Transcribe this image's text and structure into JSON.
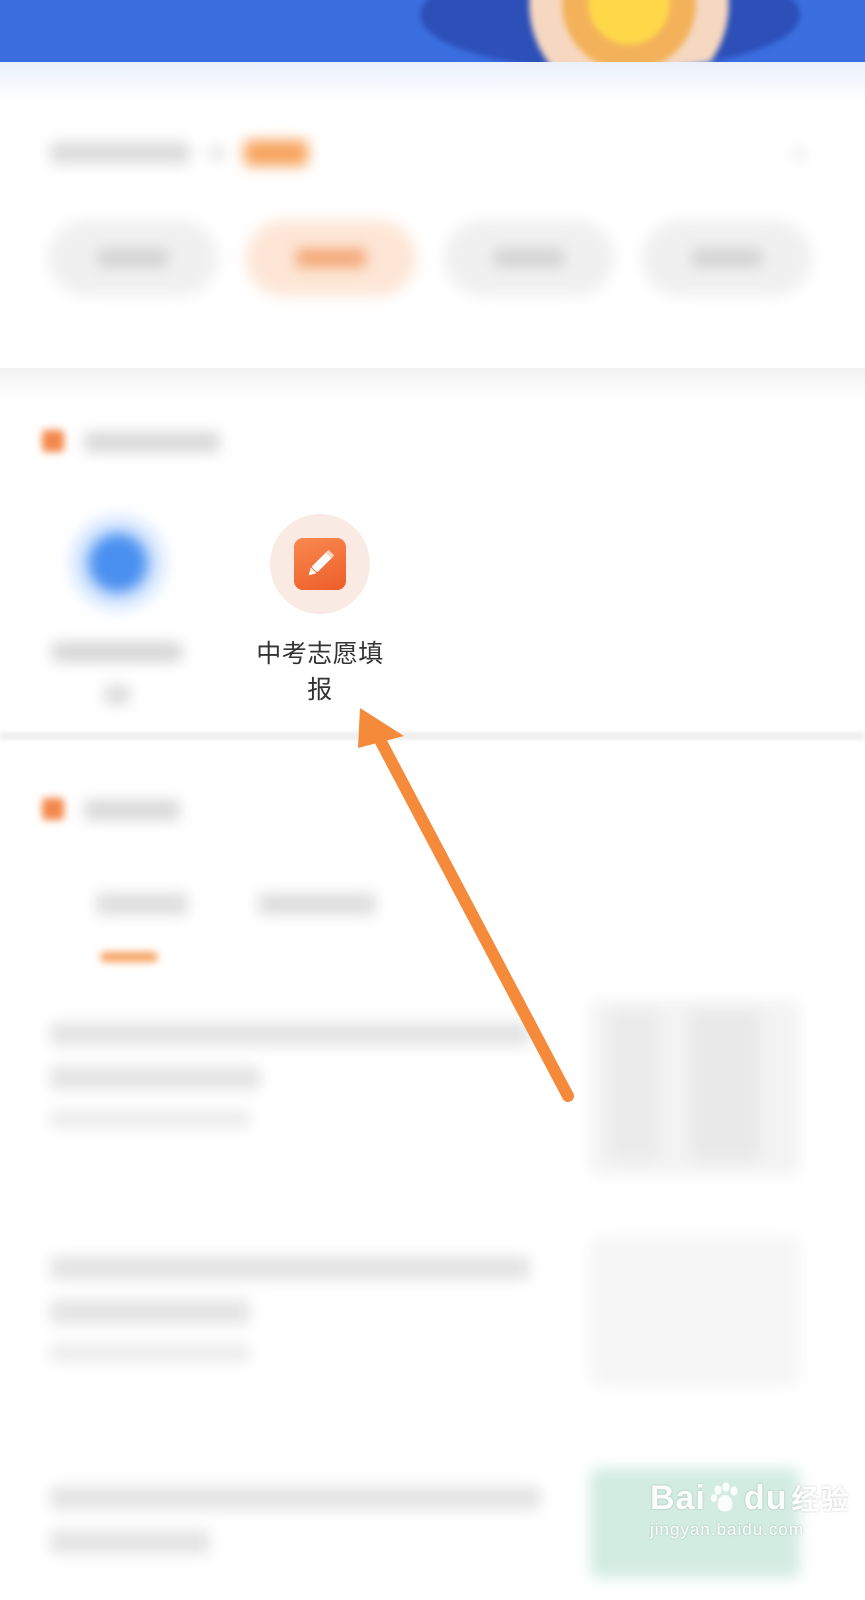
{
  "colors": {
    "brand_blue": "#3b6fe0",
    "accent_orange": "#f4874b",
    "arrow_orange": "#f48a3a",
    "tool_icon_bg": "#f9ebe4"
  },
  "tools": {
    "featured": {
      "label": "中考志愿填报",
      "icon": "pencil-edit-icon"
    }
  },
  "annotation": {
    "type": "arrow",
    "points_to": "tool-item-zhongkao-zhiyuan"
  },
  "watermark": {
    "brand": "Bai",
    "brand_suffix": "du",
    "product": "经验",
    "url": "jingyan.baidu.com"
  }
}
